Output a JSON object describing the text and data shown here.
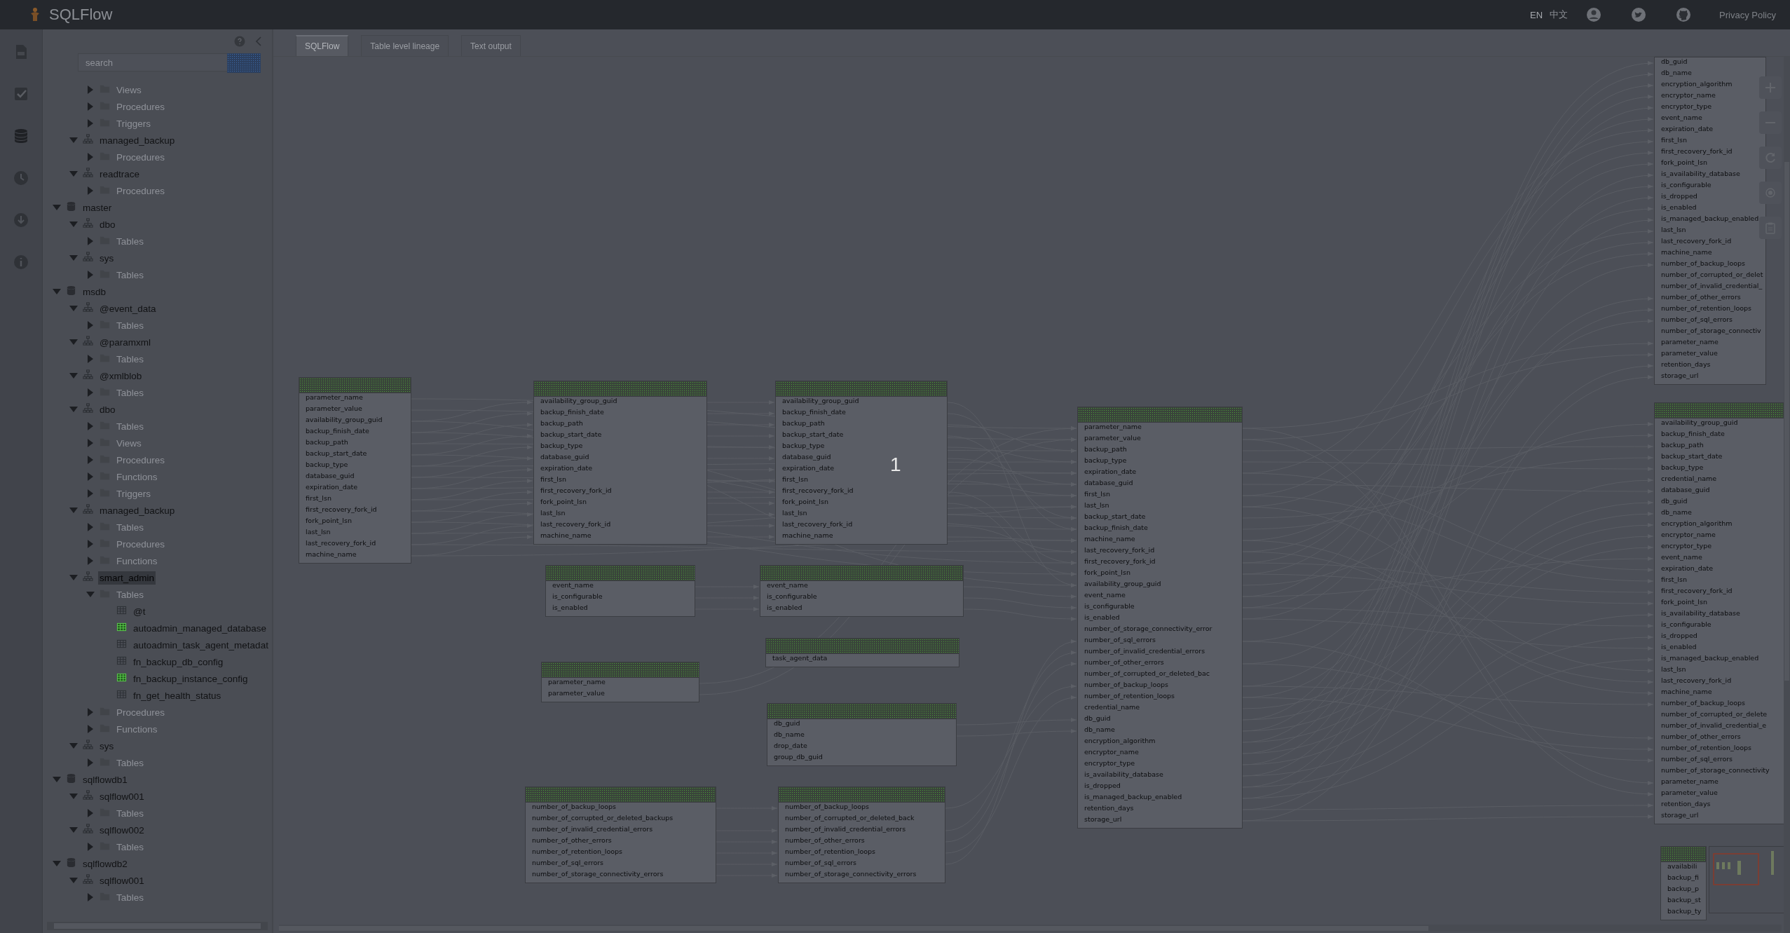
{
  "app": {
    "title": "SQLFlow"
  },
  "top_bar": {
    "languages": [
      {
        "label": "EN",
        "selected": true
      },
      {
        "label": "中文",
        "selected": false
      }
    ],
    "privacy_link": "Privacy Policy"
  },
  "sidebar": {
    "search": {
      "placeholder": "search"
    },
    "tree": [
      {
        "children": [
          {
            "children": [
              {
                "label": "Views",
                "kind": "folder",
                "expanded": false,
                "selected": false
              },
              {
                "label": "Procedures",
                "kind": "folder",
                "expanded": false,
                "selected": false
              },
              {
                "label": "Triggers",
                "kind": "folder",
                "expanded": false,
                "selected": false
              }
            ]
          },
          {
            "label": "managed_backup",
            "kind": "schema",
            "expanded": true,
            "selected": false,
            "children": [
              {
                "label": "Procedures",
                "kind": "folder",
                "expanded": false,
                "selected": false
              }
            ]
          },
          {
            "label": "readtrace",
            "kind": "schema",
            "expanded": true,
            "selected": false,
            "children": [
              {
                "label": "Procedures",
                "kind": "folder",
                "expanded": false,
                "selected": false
              }
            ]
          }
        ]
      },
      {
        "label": "master",
        "kind": "database",
        "expanded": true,
        "selected": false,
        "children": [
          {
            "label": "dbo",
            "kind": "schema",
            "expanded": true,
            "selected": false,
            "children": [
              {
                "label": "Tables",
                "kind": "folder",
                "expanded": false,
                "selected": false
              }
            ]
          },
          {
            "label": "sys",
            "kind": "schema",
            "expanded": true,
            "selected": false,
            "children": [
              {
                "label": "Tables",
                "kind": "folder",
                "expanded": false,
                "selected": false
              }
            ]
          }
        ]
      },
      {
        "label": "msdb",
        "kind": "database",
        "expanded": true,
        "selected": false,
        "children": [
          {
            "label": "@event_data",
            "kind": "schema",
            "expanded": true,
            "selected": false,
            "children": [
              {
                "label": "Tables",
                "kind": "folder",
                "expanded": false,
                "selected": false
              }
            ]
          },
          {
            "label": "@paramxml",
            "kind": "schema",
            "expanded": true,
            "selected": false,
            "children": [
              {
                "label": "Tables",
                "kind": "folder",
                "expanded": false,
                "selected": false
              }
            ]
          },
          {
            "label": "@xmlblob",
            "kind": "schema",
            "expanded": true,
            "selected": false,
            "children": [
              {
                "label": "Tables",
                "kind": "folder",
                "expanded": false,
                "selected": false
              }
            ]
          },
          {
            "label": "dbo",
            "kind": "schema",
            "expanded": true,
            "selected": false,
            "children": [
              {
                "label": "Tables",
                "kind": "folder",
                "expanded": false,
                "selected": false
              },
              {
                "label": "Views",
                "kind": "folder",
                "expanded": false,
                "selected": false
              },
              {
                "label": "Procedures",
                "kind": "folder",
                "expanded": false,
                "selected": false
              },
              {
                "label": "Functions",
                "kind": "folder",
                "expanded": false,
                "selected": false
              },
              {
                "label": "Triggers",
                "kind": "folder",
                "expanded": false,
                "selected": false
              }
            ]
          },
          {
            "label": "managed_backup",
            "kind": "schema",
            "expanded": true,
            "selected": false,
            "children": [
              {
                "label": "Tables",
                "kind": "folder",
                "expanded": false,
                "selected": false
              },
              {
                "label": "Procedures",
                "kind": "folder",
                "expanded": false,
                "selected": false
              },
              {
                "label": "Functions",
                "kind": "folder",
                "expanded": false,
                "selected": false
              }
            ]
          },
          {
            "label": "smart_admin",
            "kind": "schema",
            "expanded": true,
            "selected": true,
            "children": [
              {
                "label": "Tables",
                "kind": "folder",
                "expanded": true,
                "selected": false,
                "children": [
                  {
                    "label": "@t",
                    "kind": "table",
                    "highlighted": false,
                    "selected": false
                  },
                  {
                    "label": "autoadmin_managed_database",
                    "kind": "table",
                    "highlighted": true,
                    "selected": false
                  },
                  {
                    "label": "autoadmin_task_agent_metadat",
                    "kind": "table",
                    "highlighted": false,
                    "selected": false
                  },
                  {
                    "label": "fn_backup_db_config",
                    "kind": "table",
                    "highlighted": false,
                    "selected": false
                  },
                  {
                    "label": "fn_backup_instance_config",
                    "kind": "table",
                    "highlighted": true,
                    "selected": false
                  },
                  {
                    "label": "fn_get_health_status",
                    "kind": "table",
                    "highlighted": false,
                    "selected": false
                  }
                ]
              },
              {
                "label": "Procedures",
                "kind": "folder",
                "expanded": false,
                "selected": false
              },
              {
                "label": "Functions",
                "kind": "folder",
                "expanded": false,
                "selected": false
              }
            ]
          },
          {
            "label": "sys",
            "kind": "schema",
            "expanded": true,
            "selected": false,
            "children": [
              {
                "label": "Tables",
                "kind": "folder",
                "expanded": false,
                "selected": false
              }
            ]
          }
        ]
      },
      {
        "label": "sqlflowdb1",
        "kind": "database",
        "expanded": true,
        "selected": false,
        "children": [
          {
            "label": "sqlflow001",
            "kind": "schema",
            "expanded": true,
            "selected": false,
            "children": [
              {
                "label": "Tables",
                "kind": "folder",
                "expanded": false,
                "selected": false
              }
            ]
          },
          {
            "label": "sqlflow002",
            "kind": "schema",
            "expanded": true,
            "selected": false,
            "children": [
              {
                "label": "Tables",
                "kind": "folder",
                "expanded": false,
                "selected": false
              }
            ]
          }
        ]
      },
      {
        "label": "sqlflowdb2",
        "kind": "database",
        "expanded": true,
        "selected": false,
        "children": [
          {
            "label": "sqlflow001",
            "kind": "schema",
            "expanded": true,
            "selected": false,
            "children": [
              {
                "label": "Tables",
                "kind": "folder",
                "expanded": false,
                "selected": false
              }
            ]
          }
        ]
      }
    ]
  },
  "tabs": [
    {
      "label": "SQLFlow",
      "selected": true
    },
    {
      "label": "Table level lineage",
      "selected": false
    },
    {
      "label": "Text output",
      "selected": false
    }
  ],
  "diagram": {
    "center_label": "1",
    "tables": [
      {
        "kind": "full",
        "columns": [
          "parameter_name",
          "parameter_value",
          "availability_group_guid",
          "backup_finish_date",
          "backup_path",
          "backup_start_date",
          "backup_type",
          "database_guid",
          "expiration_date",
          "first_lsn",
          "first_recovery_fork_id",
          "fork_point_lsn",
          "last_lsn",
          "last_recovery_fork_id",
          "machine_name"
        ]
      },
      {
        "kind": "full",
        "columns": [
          "availability_group_guid",
          "backup_finish_date",
          "backup_path",
          "backup_start_date",
          "backup_type",
          "database_guid",
          "expiration_date",
          "first_lsn",
          "first_recovery_fork_id",
          "fork_point_lsn",
          "last_lsn",
          "last_recovery_fork_id",
          "machine_name"
        ]
      },
      {
        "kind": "full",
        "columns": [
          "availability_group_guid",
          "backup_finish_date",
          "backup_path",
          "backup_start_date",
          "backup_type",
          "database_guid",
          "expiration_date",
          "first_lsn",
          "first_recovery_fork_id",
          "fork_point_lsn",
          "last_lsn",
          "last_recovery_fork_id",
          "machine_name"
        ]
      },
      {
        "kind": "full",
        "columns": [
          "event_name",
          "is_configurable",
          "is_enabled"
        ]
      },
      {
        "kind": "full",
        "columns": [
          "event_name",
          "is_configurable",
          "is_enabled"
        ]
      },
      {
        "kind": "full",
        "columns": [
          "task_agent_data"
        ]
      },
      {
        "kind": "full",
        "columns": [
          "parameter_name",
          "parameter_value"
        ]
      },
      {
        "kind": "full",
        "columns": [
          "db_guid",
          "db_name",
          "drop_date",
          "group_db_guid"
        ]
      },
      {
        "kind": "full",
        "columns": [
          "number_of_backup_loops",
          "number_of_corrupted_or_deleted_backups",
          "number_of_invalid_credential_errors",
          "number_of_other_errors",
          "number_of_retention_loops",
          "number_of_sql_errors",
          "number_of_storage_connectivity_errors"
        ]
      },
      {
        "kind": "full",
        "columns": [
          "number_of_backup_loops",
          "number_of_corrupted_or_deleted_back",
          "number_of_invalid_credential_errors",
          "number_of_other_errors",
          "number_of_retention_loops",
          "number_of_sql_errors",
          "number_of_storage_connectivity_errors"
        ]
      },
      {
        "kind": "full",
        "columns": [
          "parameter_name",
          "parameter_value",
          "backup_path",
          "backup_type",
          "expiration_date",
          "database_guid",
          "first_lsn",
          "last_lsn",
          "backup_start_date",
          "backup_finish_date",
          "machine_name",
          "last_recovery_fork_id",
          "first_recovery_fork_id",
          "fork_point_lsn",
          "availability_group_guid",
          "event_name",
          "is_configurable",
          "is_enabled",
          "number_of_storage_connectivity_error",
          "number_of_sql_errors",
          "number_of_invalid_credential_errors",
          "number_of_other_errors",
          "number_of_corrupted_or_deleted_bac",
          "number_of_backup_loops",
          "number_of_retention_loops",
          "credential_name",
          "db_guid",
          "db_name",
          "encryption_algorithm",
          "encryptor_name",
          "encryptor_type",
          "is_availability_database",
          "is_dropped",
          "is_managed_backup_enabled",
          "retention_days",
          "storage_url"
        ]
      },
      {
        "kind": "continued",
        "columns": [
          "db_guid",
          "db_name",
          "encryption_algorithm",
          "encryptor_name",
          "encryptor_type",
          "event_name",
          "expiration_date",
          "first_lsn",
          "first_recovery_fork_id",
          "fork_point_lsn",
          "is_availability_database",
          "is_configurable",
          "is_dropped",
          "is_enabled",
          "is_managed_backup_enabled",
          "last_lsn",
          "last_recovery_fork_id",
          "machine_name",
          "number_of_backup_loops",
          "number_of_corrupted_or_delet",
          "number_of_invalid_credential_",
          "number_of_other_errors",
          "number_of_retention_loops",
          "number_of_sql_errors",
          "number_of_storage_connectiv",
          "parameter_name",
          "parameter_value",
          "retention_days",
          "storage_url"
        ]
      },
      {
        "kind": "full",
        "columns": [
          "availability_group_guid",
          "backup_finish_date",
          "backup_path",
          "backup_start_date",
          "backup_type",
          "credential_name",
          "database_guid",
          "db_guid",
          "db_name",
          "encryption_algorithm",
          "encryptor_name",
          "encryptor_type",
          "event_name",
          "expiration_date",
          "first_lsn",
          "first_recovery_fork_id",
          "fork_point_lsn",
          "is_availability_database",
          "is_configurable",
          "is_dropped",
          "is_enabled",
          "is_managed_backup_enabled",
          "last_lsn",
          "last_recovery_fork_id",
          "machine_name",
          "number_of_backup_loops",
          "number_of_corrupted_or_delete",
          "number_of_invalid_credential_e",
          "number_of_other_errors",
          "number_of_retention_loops",
          "number_of_sql_errors",
          "number_of_storage_connectivity",
          "parameter_name",
          "parameter_value",
          "retention_days",
          "storage_url"
        ]
      },
      {
        "kind": "full",
        "columns": [
          "availabili",
          "backup_fi",
          "backup_p",
          "backup_st",
          "backup_ty"
        ]
      }
    ]
  }
}
